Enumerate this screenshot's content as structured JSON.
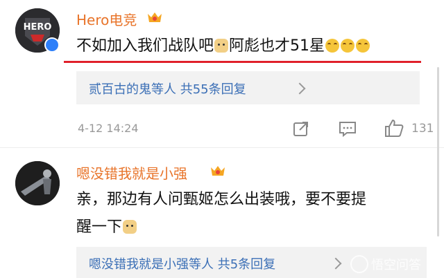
{
  "comment1": {
    "avatar_label": "HERO",
    "username": "Hero电竞",
    "text_part1": "不如加入我们战队吧",
    "text_part2": "阿彪也才51星",
    "reply_summary": "贰百古的鬼等人 共55条回复",
    "timestamp": "4-12 14:24",
    "like_count": "131"
  },
  "comment2": {
    "username": "嗯没错我就是小强",
    "text_line1": "亲，那边有人问甄姬怎么出装哦，要不要提",
    "text_line2": "醒一下",
    "reply_summary": "嗯没错我就是小强等人 共5条回复"
  },
  "watermark": {
    "text": "悟空问答"
  },
  "icons": [
    "verified-icon",
    "vip-crown-icon",
    "share-icon",
    "comment-icon",
    "like-icon",
    "chevron-right-icon"
  ],
  "colors": {
    "username": "#e8742a",
    "reply_link": "#3b6fb6",
    "highlight": "#e0202a"
  }
}
